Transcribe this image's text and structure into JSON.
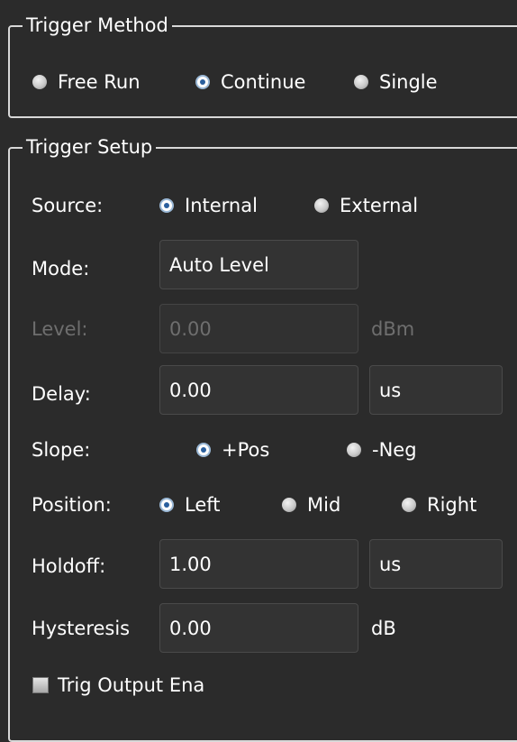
{
  "trigger_method": {
    "title": "Trigger Method",
    "options": [
      {
        "label": "Free Run",
        "selected": false
      },
      {
        "label": "Continue",
        "selected": true
      },
      {
        "label": "Single",
        "selected": false
      }
    ]
  },
  "trigger_setup": {
    "title": "Trigger Setup",
    "source": {
      "label": "Source:",
      "options": [
        {
          "label": "Internal",
          "selected": true
        },
        {
          "label": "External",
          "selected": false
        }
      ]
    },
    "mode": {
      "label": "Mode:",
      "value": "Auto Level"
    },
    "level": {
      "label": "Level:",
      "value": "0.00",
      "unit": "dBm",
      "enabled": false
    },
    "delay": {
      "label": "Delay:",
      "value": "0.00",
      "unit": "us"
    },
    "slope": {
      "label": "Slope:",
      "options": [
        {
          "label": "+Pos",
          "selected": true
        },
        {
          "label": "-Neg",
          "selected": false
        }
      ]
    },
    "position": {
      "label": "Position:",
      "options": [
        {
          "label": "Left",
          "selected": true
        },
        {
          "label": "Mid",
          "selected": false
        },
        {
          "label": "Right",
          "selected": false
        }
      ]
    },
    "holdoff": {
      "label": "Holdoff:",
      "value": "1.00",
      "unit": "us"
    },
    "hysteresis": {
      "label": "Hysteresis",
      "value": "0.00",
      "unit": "dB"
    },
    "trig_output": {
      "label": "Trig Output Ena",
      "checked": false
    }
  }
}
